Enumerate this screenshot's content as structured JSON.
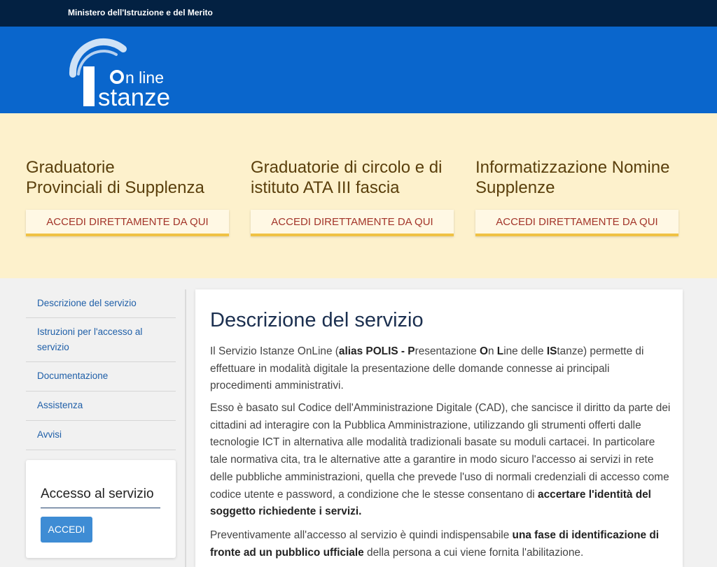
{
  "topbar": {
    "ministry": "Ministero dell'Istruzione e del Merito"
  },
  "logo": {
    "brand": "Istanze On line"
  },
  "cards": [
    {
      "title_l1": "Graduatorie",
      "title_l2": "Provinciali di Supplenza",
      "button": "ACCEDI DIRETTAMENTE DA QUI"
    },
    {
      "title_l1": "Graduatorie di circolo e di",
      "title_l2": "istituto ATA III fascia",
      "button": "ACCEDI DIRETTAMENTE DA QUI"
    },
    {
      "title_l1": "Informatizzazione Nomine",
      "title_l2": "Supplenze",
      "button": "ACCEDI DIRETTAMENTE DA QUI"
    }
  ],
  "sidebar": {
    "items": [
      {
        "label": "Descrizione del servizio"
      },
      {
        "label_l1": "Istruzioni per l'accesso al",
        "label_l2": "servizio"
      },
      {
        "label": "Documentazione"
      },
      {
        "label": "Assistenza"
      },
      {
        "label": "Avvisi"
      }
    ]
  },
  "access": {
    "title": "Accesso al servizio",
    "button": "ACCEDI"
  },
  "content": {
    "title": "Descrizione del servizio",
    "p1": {
      "a": "Il Servizio Istanze OnLine (",
      "b": "alias POLIS - P",
      "c": "resentazione ",
      "d": "O",
      "e": "n ",
      "f": "L",
      "g": "ine delle ",
      "h": "IS",
      "i": "tanze) permette di effettuare in modalità digitale la presentazione delle domande connesse ai principali procedimenti amministrativi."
    },
    "p2": {
      "a": "Esso è basato sul Codice dell'Amministrazione Digitale (CAD), che sancisce il diritto da parte dei cittadini ad interagire con la Pubblica Amministrazione, utilizzando gli strumenti offerti dalle tecnologie ICT in alternativa alle modalità tradizionali basate su moduli cartacei. In particolare tale normativa cita, tra le alternative atte a garantire in modo sicuro l'accesso ai servizi in rete delle pubbliche amministrazioni, quella che prevede l'uso di normali credenziali di accesso come codice utente e password, a condizione che le stesse consentano di ",
      "b": "accertare l'identità del soggetto richiedente i servizi."
    },
    "p3": {
      "a": "Preventivamente all'accesso al servizio è quindi indispensabile ",
      "b": "una fase di identificazione di fronte ad un pubblico ufficiale",
      "c": " della persona a cui viene fornita l'abilitazione."
    }
  },
  "colors": {
    "topbar": "#032142",
    "header": "#0a66cc",
    "banner": "#fdf1cc",
    "button_text": "#a3352a",
    "button_border": "#f0c244",
    "link": "#1f5fa8",
    "accedi": "#3e8cd4"
  }
}
